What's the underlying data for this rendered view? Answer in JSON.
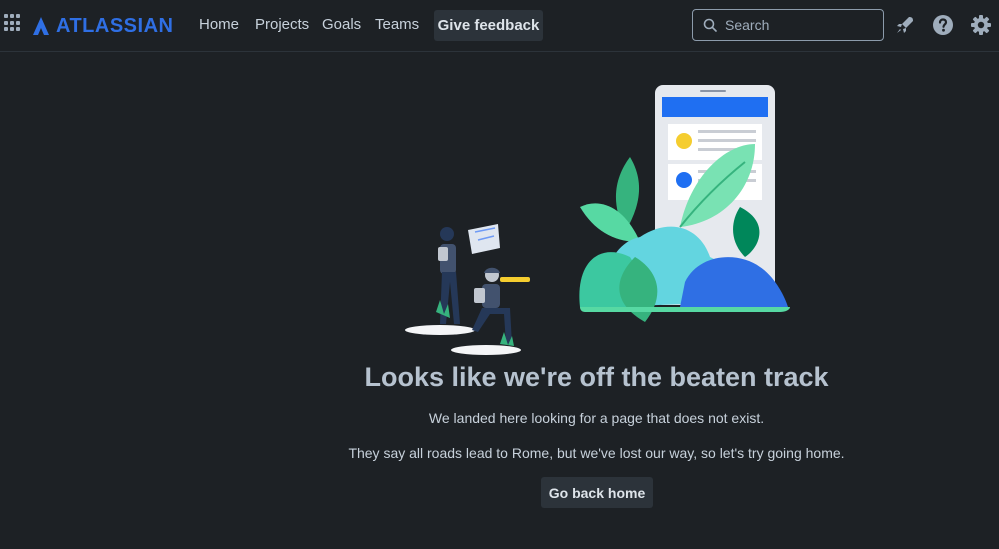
{
  "header": {
    "brand": "ATLASSIAN",
    "nav": [
      {
        "label": "Home"
      },
      {
        "label": "Projects"
      },
      {
        "label": "Goals"
      },
      {
        "label": "Teams"
      }
    ],
    "feedback_label": "Give feedback",
    "search": {
      "placeholder": "Search",
      "value": ""
    },
    "icons": [
      "app-switcher-icon",
      "notifications-icon",
      "help-icon",
      "settings-icon"
    ]
  },
  "main": {
    "title": "Looks like we're off the beaten track",
    "message_1": "We landed here looking for a page that does not exist.",
    "message_2": "They say all roads lead to Rome, but we've lost our way, so let's try going home.",
    "home_button": "Go back home"
  },
  "colors": {
    "background": "#1d2125",
    "brand_blue": "#2f6fe4",
    "button_bg": "#2c333a"
  }
}
